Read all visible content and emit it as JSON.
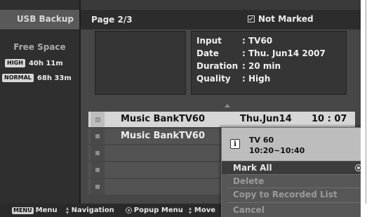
{
  "sidebar": {
    "title": "USB Backup",
    "free_space_label": "Free Space",
    "modes": [
      {
        "badge": "HIGH",
        "value": "40h 11m"
      },
      {
        "badge": "NORMAL",
        "value": "68h 33m"
      }
    ]
  },
  "header": {
    "page": "Page 2/3",
    "filter": "Not Marked"
  },
  "info": {
    "rows": [
      {
        "label": "Input",
        "value": ": TV60"
      },
      {
        "label": "Date",
        "value": ": Thu. Jun14 2007"
      },
      {
        "label": "Duration",
        "value": ": 20 min"
      },
      {
        "label": "Quality",
        "value": ": High"
      }
    ]
  },
  "list": {
    "rows": [
      {
        "title": "Music Bank",
        "channel": "TV60",
        "date": "Thu.Jun14",
        "time": "10 : 07"
      },
      {
        "title": "Music Bank",
        "channel": "TV60",
        "date": "",
        "time": ""
      }
    ]
  },
  "bottombar": {
    "menu_key": "MENU",
    "menu_label": "Menu",
    "nav_label": "Navigation",
    "popup_label": "Popup Menu",
    "move_label": "Move"
  },
  "popup": {
    "channel": "TV 60",
    "time_range": "10:20~10:40",
    "options": [
      {
        "label": "Mark All",
        "state": "selected"
      },
      {
        "label": "Delete",
        "state": "disabled"
      },
      {
        "label": "Copy to Recorded List",
        "state": "disabled"
      },
      {
        "label": "Cancel",
        "state": "disabled"
      }
    ]
  }
}
